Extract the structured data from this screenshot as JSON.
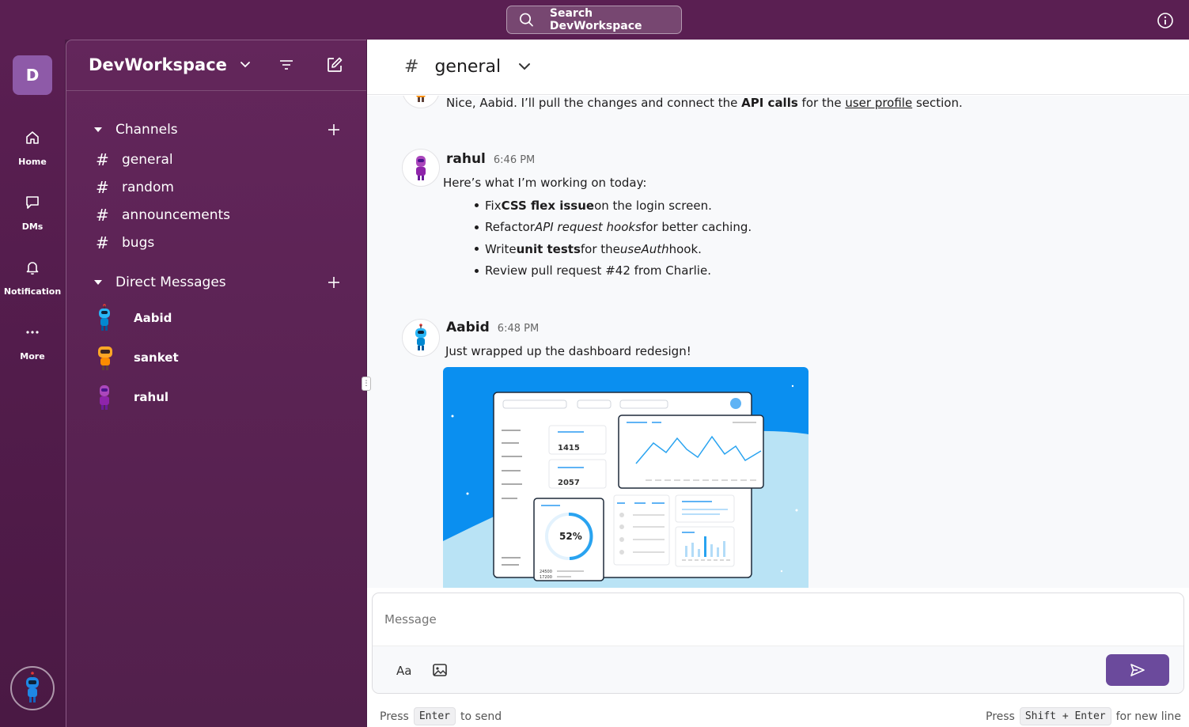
{
  "search": {
    "label": "Search DevWorkspace"
  },
  "rail": {
    "workspace_initial": "D",
    "items": [
      {
        "label": "Home",
        "icon": "home-icon"
      },
      {
        "label": "DMs",
        "icon": "message-icon"
      },
      {
        "label": "Notification",
        "icon": "bell-icon"
      },
      {
        "label": "More",
        "icon": "more-icon"
      }
    ]
  },
  "sidebar": {
    "workspace_name": "DevWorkspace",
    "channels_label": "Channels",
    "channels": [
      "general",
      "random",
      "announcements",
      "bugs"
    ],
    "dms_label": "Direct Messages",
    "dms": [
      "Aabid",
      "sanket",
      "rahul"
    ]
  },
  "channel": {
    "name": "general"
  },
  "messages": {
    "prev": {
      "text_a": "Nice, Aabid. I’ll pull the changes and connect the ",
      "text_bold": "API calls",
      "text_b": " for the ",
      "text_link": "user profile",
      "text_c": " section."
    },
    "rahul": {
      "author": "rahul",
      "time": "6:46 PM",
      "intro": "Here’s what I’m working on today:",
      "b1_a": "Fix ",
      "b1_bold": "CSS flex issue",
      "b1_b": " on the login screen.",
      "b2_a": "Refactor ",
      "b2_em": "API request hooks",
      "b2_b": " for better caching.",
      "b3_a": "Write ",
      "b3_bold": "unit tests",
      "b3_b": " for the ",
      "b3_em": "useAuth",
      "b3_c": " hook.",
      "b4": "Review pull request #42 from Charlie."
    },
    "aabid": {
      "author": "Aabid",
      "time": "6:48 PM",
      "text": "Just wrapped up the dashboard redesign!",
      "image": {
        "stat1": "1415",
        "stat2": "2057",
        "percent": "52%",
        "meta1": "24500",
        "meta2": "17200"
      }
    }
  },
  "composer": {
    "placeholder": "Message",
    "format_label": "Aa",
    "hint_left_a": "Press",
    "hint_left_key": "Enter",
    "hint_left_b": "to send",
    "hint_right_a": "Press",
    "hint_right_key": "Shift + Enter",
    "hint_right_b": "for new line"
  },
  "colors": {
    "rail_bg": "#5a1f52",
    "sidebar_bg": "#63265b",
    "send_button": "#6b4a9c",
    "image_blue": "#0a8ff0"
  }
}
